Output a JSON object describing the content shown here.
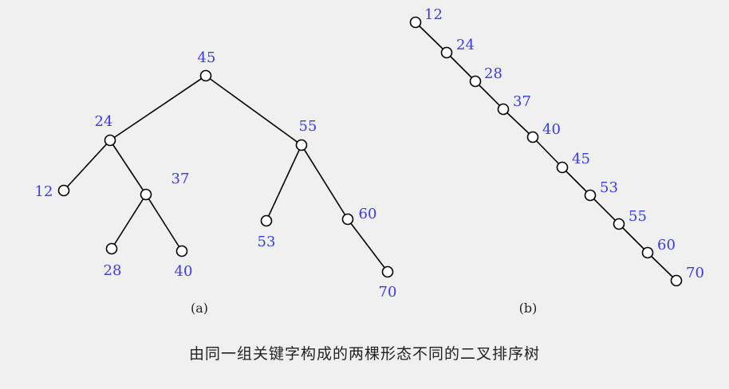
{
  "tree_a": {
    "sublabel": "(a)",
    "nodes": [
      {
        "id": "a45",
        "label": "45"
      },
      {
        "id": "a24",
        "label": "24"
      },
      {
        "id": "a55",
        "label": "55"
      },
      {
        "id": "a12",
        "label": "12"
      },
      {
        "id": "a37",
        "label": "37"
      },
      {
        "id": "a28",
        "label": "28"
      },
      {
        "id": "a40",
        "label": "40"
      },
      {
        "id": "a53",
        "label": "53"
      },
      {
        "id": "a60",
        "label": "60"
      },
      {
        "id": "a70",
        "label": "70"
      }
    ],
    "edges": [
      [
        "a45",
        "a24"
      ],
      [
        "a45",
        "a55"
      ],
      [
        "a24",
        "a12"
      ],
      [
        "a24",
        "a37"
      ],
      [
        "a37",
        "a28"
      ],
      [
        "a37",
        "a40"
      ],
      [
        "a55",
        "a53"
      ],
      [
        "a55",
        "a60"
      ],
      [
        "a60",
        "a70"
      ]
    ]
  },
  "tree_b": {
    "sublabel": "(b)",
    "nodes": [
      {
        "id": "b12",
        "label": "12"
      },
      {
        "id": "b24",
        "label": "24"
      },
      {
        "id": "b28",
        "label": "28"
      },
      {
        "id": "b37",
        "label": "37"
      },
      {
        "id": "b40",
        "label": "40"
      },
      {
        "id": "b45",
        "label": "45"
      },
      {
        "id": "b53",
        "label": "53"
      },
      {
        "id": "b55",
        "label": "55"
      },
      {
        "id": "b60",
        "label": "60"
      },
      {
        "id": "b70",
        "label": "70"
      }
    ],
    "edges": [
      [
        "b12",
        "b24"
      ],
      [
        "b24",
        "b28"
      ],
      [
        "b28",
        "b37"
      ],
      [
        "b37",
        "b40"
      ],
      [
        "b40",
        "b45"
      ],
      [
        "b45",
        "b53"
      ],
      [
        "b53",
        "b55"
      ],
      [
        "b55",
        "b60"
      ],
      [
        "b60",
        "b70"
      ]
    ]
  },
  "caption": "由同一组关键字构成的两棵形态不同的二叉排序树",
  "colors": {
    "background": "#f0f0f0",
    "node_label": "#3a3ae6",
    "edge": "#000000",
    "caption": "#222222"
  }
}
